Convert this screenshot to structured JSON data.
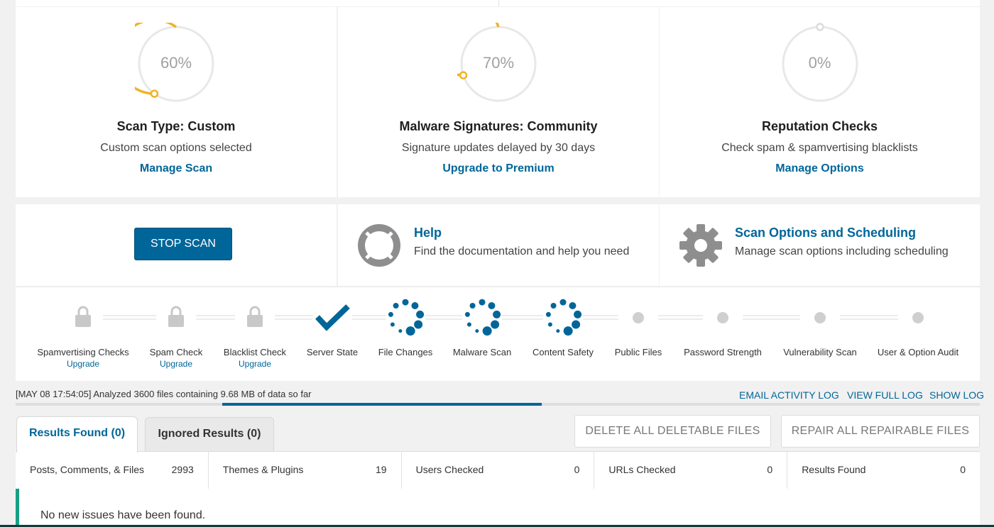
{
  "cards": [
    {
      "percent": 60,
      "percent_label": "60%",
      "title": "Scan Type: Custom",
      "subtitle": "Custom scan options selected",
      "link": "Manage Scan"
    },
    {
      "percent": 70,
      "percent_label": "70%",
      "title": "Malware Signatures: Community",
      "subtitle": "Signature updates delayed by 30 days",
      "link": "Upgrade to Premium"
    },
    {
      "percent": 0,
      "percent_label": "0%",
      "title": "Reputation Checks",
      "subtitle": "Check spam & spamvertising blacklists",
      "link": "Manage Options"
    }
  ],
  "actions": {
    "stop_scan": "STOP SCAN",
    "help_title": "Help",
    "help_desc": "Find the documentation and help you need",
    "options_title": "Scan Options and Scheduling",
    "options_desc": "Manage scan options including scheduling"
  },
  "steps": [
    {
      "label": "Spamvertising Checks",
      "state": "locked",
      "upgrade": "Upgrade"
    },
    {
      "label": "Spam Check",
      "state": "locked",
      "upgrade": "Upgrade"
    },
    {
      "label": "Blacklist Check",
      "state": "locked",
      "upgrade": "Upgrade"
    },
    {
      "label": "Server State",
      "state": "complete"
    },
    {
      "label": "File Changes",
      "state": "running"
    },
    {
      "label": "Malware Scan",
      "state": "running"
    },
    {
      "label": "Content Safety",
      "state": "running"
    },
    {
      "label": "Public Files",
      "state": "pending"
    },
    {
      "label": "Password Strength",
      "state": "pending"
    },
    {
      "label": "Vulnerability Scan",
      "state": "pending"
    },
    {
      "label": "User & Option Audit",
      "state": "pending"
    }
  ],
  "log": {
    "status": "[MAY 08 17:54:05] Analyzed 3600 files containing 9.68 MB of data so far",
    "email_link": "EMAIL ACTIVITY LOG",
    "full_link": "VIEW FULL LOG",
    "show_link": "SHOW LOG"
  },
  "tabs": {
    "results": "Results Found (0)",
    "ignored": "Ignored Results (0)"
  },
  "buttons": {
    "delete_all": "DELETE ALL DELETABLE FILES",
    "repair_all": "REPAIR ALL REPAIRABLE FILES"
  },
  "stats": [
    {
      "label": "Posts, Comments, & Files",
      "value": "2993"
    },
    {
      "label": "Themes & Plugins",
      "value": "19"
    },
    {
      "label": "Users Checked",
      "value": "0"
    },
    {
      "label": "URLs Checked",
      "value": "0"
    },
    {
      "label": "Results Found",
      "value": "0"
    }
  ],
  "results_message": "No new issues have been found.",
  "colors": {
    "accent": "#006699",
    "gauge": "#f0b323",
    "gauge_track": "#e8e8e8",
    "pending": "#cfcfcf",
    "locked": "#c8c8c8",
    "success_border": "#16a085"
  }
}
